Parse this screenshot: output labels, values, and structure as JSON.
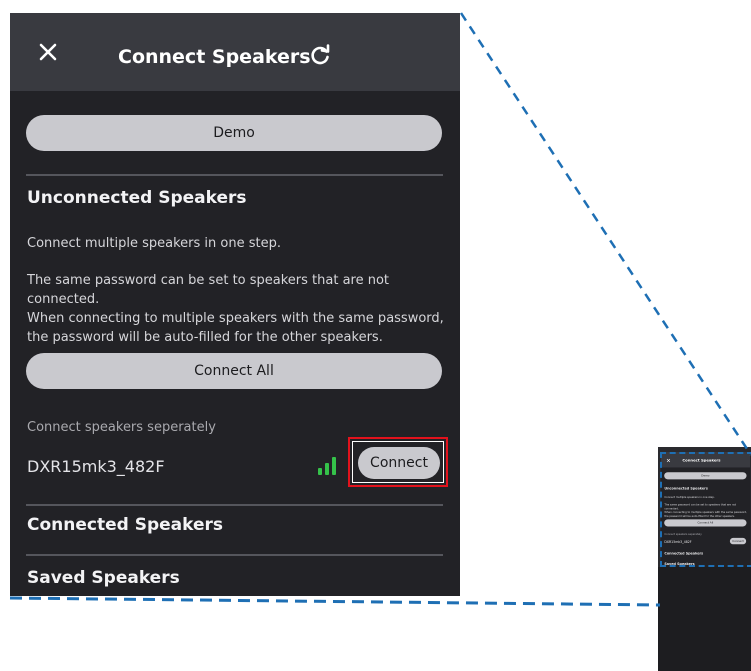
{
  "header": {
    "close_icon": "close-icon",
    "title": "Connect Speakers",
    "refresh_icon": "refresh-icon"
  },
  "demo_button": "Demo",
  "unconnected": {
    "title": "Unconnected Speakers",
    "intro": "Connect multiple speakers in one step.",
    "password_line1": "The same password can be set to speakers that are not connected.",
    "password_line2": "When connecting to multiple speakers with the same password, the password will be auto-filled for the other speakers.",
    "connect_all_button": "Connect All",
    "separate_label": "Connect speakers seperately",
    "speakers": [
      {
        "name": "DXR15mk3_482F",
        "signal_icon": "signal-strength-icon",
        "connect_label": "Connect"
      }
    ]
  },
  "connected": {
    "title": "Connected Speakers"
  },
  "saved": {
    "title": "Saved Speakers"
  },
  "colors": {
    "panel_bg": "#222226",
    "header_bg": "#393a40",
    "button_bg": "#c9c9ce",
    "signal_green": "#35c24a",
    "highlight_red": "#e2121c",
    "guide_blue": "#1e6fb4"
  }
}
